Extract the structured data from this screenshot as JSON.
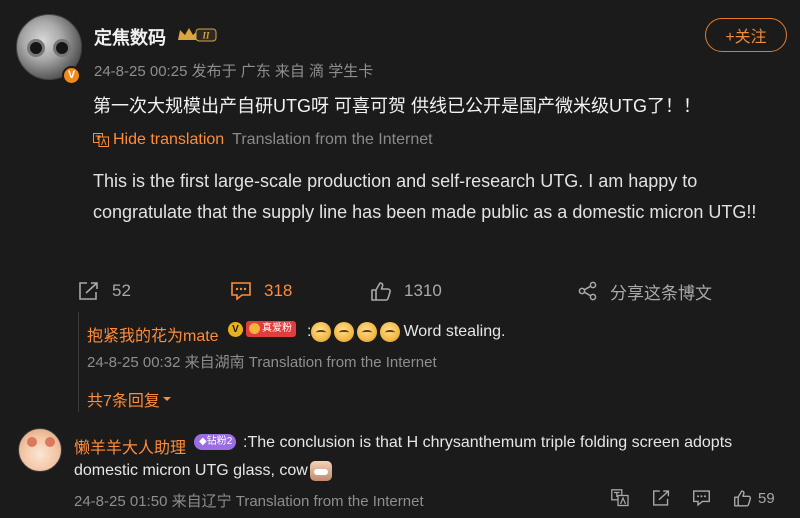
{
  "post": {
    "username": "定焦数码",
    "meta": "24-8-25 00:25 发布于 广东 来自 滴 学生卡",
    "follow_label": "+关注",
    "text": "第一次大规模出产自研UTG呀 可喜可贺 供线已公开是国产微米级UTG了！！",
    "hide_translation": "Hide translation",
    "translation_source": "Translation from the Internet",
    "translation": "This is the first large-scale production and self-research UTG. I am happy to congratulate that the supply line has been made public as a domestic micron UTG!!",
    "reposts": "52",
    "comments": "318",
    "likes": "1310",
    "share_label": "分享这条博文"
  },
  "reply": {
    "username": "抱紧我的花为mate",
    "fan_badge": "真爱粉",
    "text": ":Word stealing.",
    "emoji_names": [
      "emoji-1",
      "emoji-2",
      "emoji-3",
      "emoji-4"
    ],
    "meta": "24-8-25 00:32 来自湖南 Translation from the Internet",
    "more": "共7条回复"
  },
  "comment2": {
    "username": "懒羊羊大人助理",
    "badge": "钻粉2",
    "text_line1": ":The conclusion is that H chrysanthemum triple folding screen adopts",
    "text_line2": "domestic micron UTG glass, cow",
    "meta": "24-8-25 01:50 来自辽宁 Translation from the Internet",
    "likes": "59"
  },
  "colors": {
    "accent": "#ff8c3b",
    "background": "#1b1b1b",
    "muted": "#8e8e8e"
  }
}
